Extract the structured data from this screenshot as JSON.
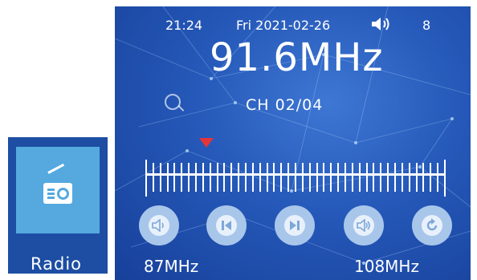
{
  "tile": {
    "icon": "radio-icon",
    "label": "Radio",
    "background": "#1d4ea3",
    "icon_background": "#55a9df"
  },
  "status": {
    "time": "21:24",
    "date": "Fri  2021-02-26",
    "speaker_icon": "speaker-icon",
    "volume": "8"
  },
  "frequency": {
    "display": "91.6MHz"
  },
  "channel": {
    "label": "CH 02/04"
  },
  "search_icon": "search-icon",
  "tuner": {
    "marker_color": "#e53539",
    "band_min": "87MHz",
    "band_max": "108MHz"
  },
  "controls": [
    {
      "name": "volume-down-icon"
    },
    {
      "name": "previous-station-icon"
    },
    {
      "name": "next-station-icon"
    },
    {
      "name": "volume-up-icon"
    },
    {
      "name": "return-icon"
    }
  ],
  "colors": {
    "screen_bg": "#2558b8",
    "control_outer": "#a8c6ea",
    "control_inner": "#e8f1fb",
    "text": "#ffffff"
  }
}
